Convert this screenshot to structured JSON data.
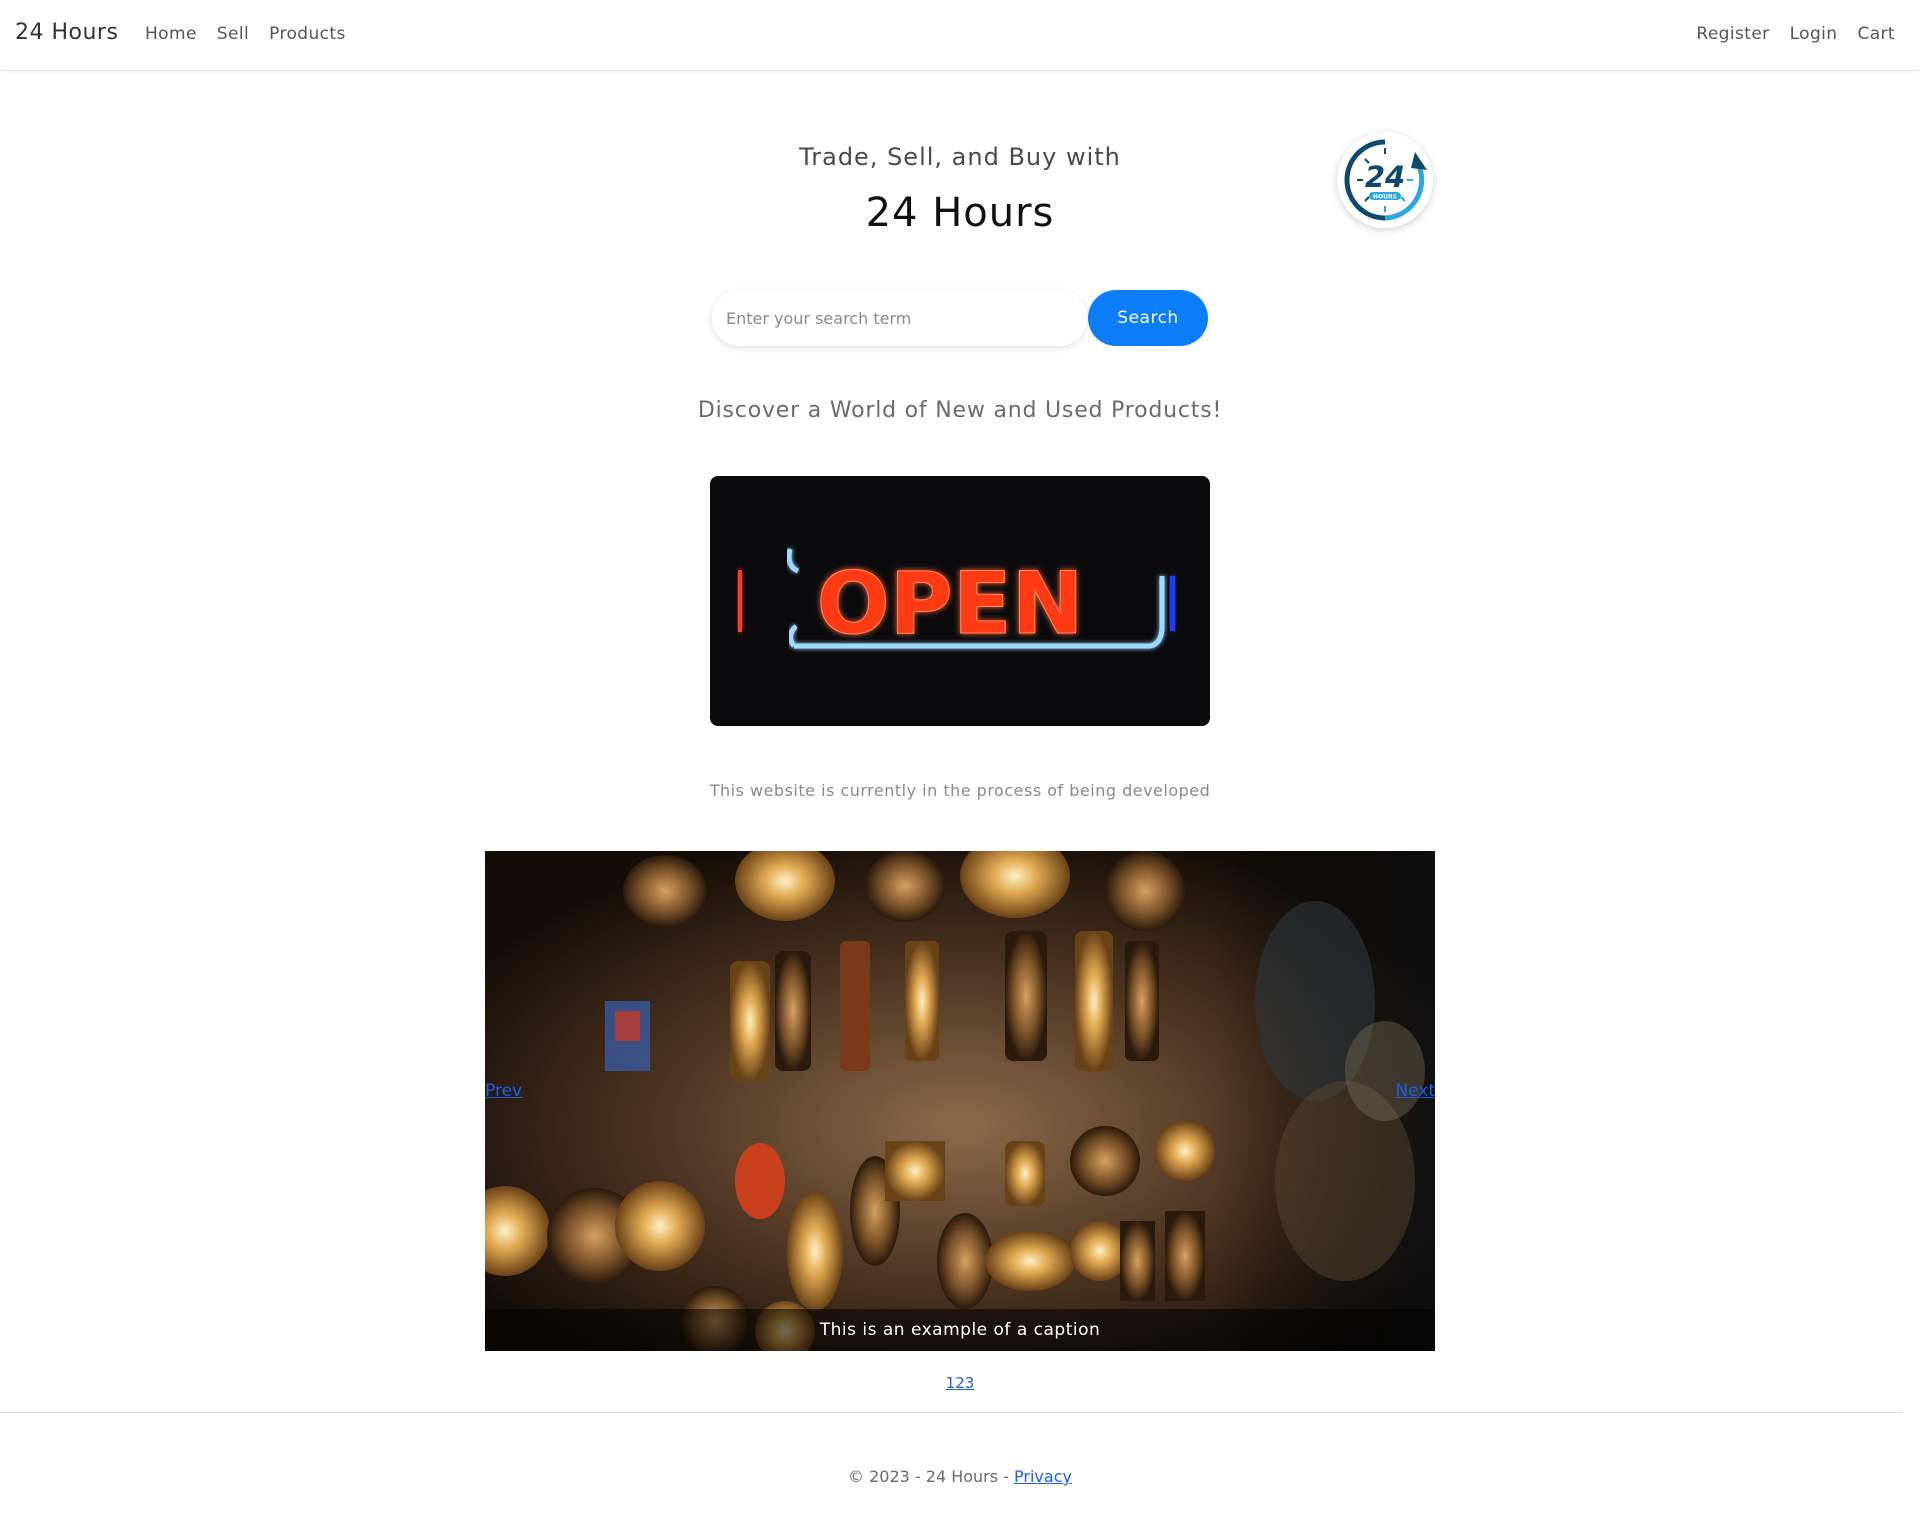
{
  "navbar": {
    "brand": "24 Hours",
    "left_links": [
      "Home",
      "Sell",
      "Products"
    ],
    "right_links": [
      "Register",
      "Login",
      "Cart"
    ]
  },
  "hero": {
    "subtitle": "Trade, Sell, and Buy with",
    "title": "24 Hours",
    "logo": {
      "number": "24",
      "label": "HOURS",
      "icon": "24-hours-clock-logo-icon"
    }
  },
  "search": {
    "placeholder": "Enter your search term",
    "value": "",
    "button_label": "Search"
  },
  "discover_text": "Discover a World of New and Used Products!",
  "open_sign": {
    "text": "OPEN"
  },
  "dev_note": "This website is currently in the process of being developed",
  "carousel": {
    "prev_label": "Prev",
    "next_label": "Next",
    "caption": "This is an example of a caption",
    "indicators": [
      "1",
      "2",
      "3"
    ]
  },
  "footer": {
    "copyright": "© 2023 - 24 Hours - ",
    "privacy_label": "Privacy"
  },
  "colors": {
    "primary": "#0d7ef9",
    "link": "#1a5de8",
    "logo_navy": "#0f4a6e",
    "logo_cyan": "#29a8e0"
  }
}
